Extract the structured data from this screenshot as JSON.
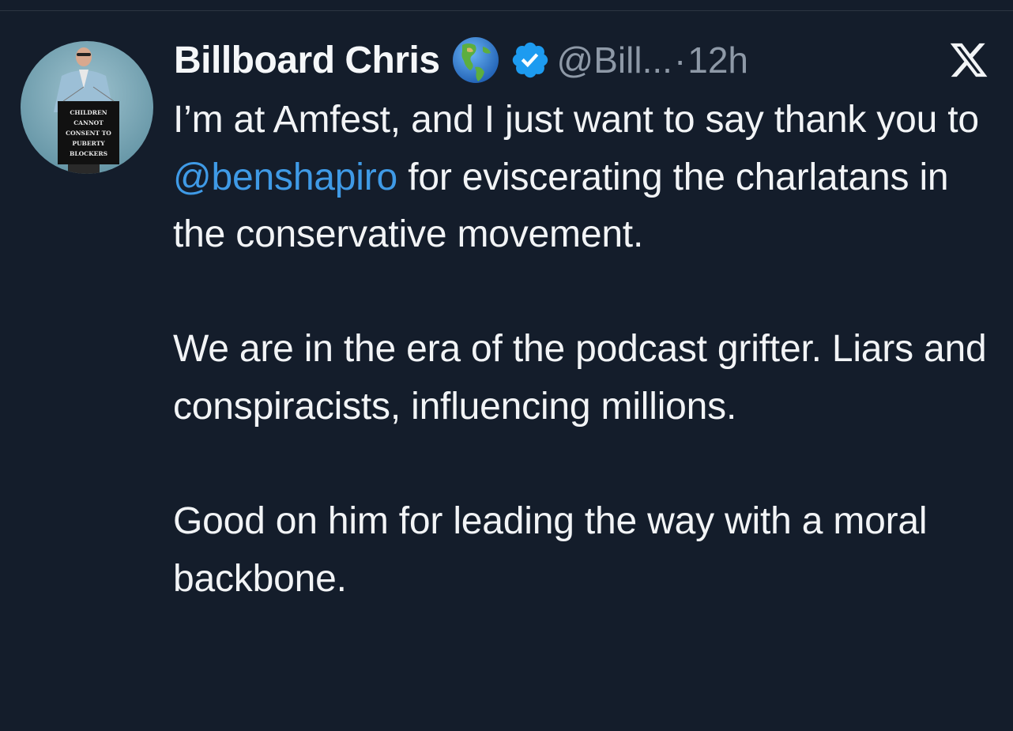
{
  "tweet": {
    "author_name": "Billboard Chris",
    "author_handle": "@Bill...",
    "separator": "·",
    "timestamp": "12h",
    "avatar_sign": [
      "CHILDREN",
      "CANNOT",
      "CONSENT TO",
      "PUBERTY",
      "BLOCKERS"
    ],
    "icons": {
      "globe": "globe-americas-icon",
      "verified": "verified-badge-icon",
      "platform": "x-logo-icon"
    },
    "colors": {
      "background": "#141d2b",
      "text": "#f2f4f6",
      "muted": "#8e99a7",
      "mention": "#3f9ae6",
      "verified": "#1d9bf0"
    },
    "body": {
      "p1_before": "I’m at Amfest, and I just want to say thank you to",
      "p1_mention": "@benshapiro",
      "p1_after": "for eviscerating the charlatans in the conservative movement.",
      "p2": "We are in the era of the podcast grifter. Liars and conspiracists, influencing millions.",
      "p3": "Good on him for leading the way with a moral backbone."
    }
  }
}
